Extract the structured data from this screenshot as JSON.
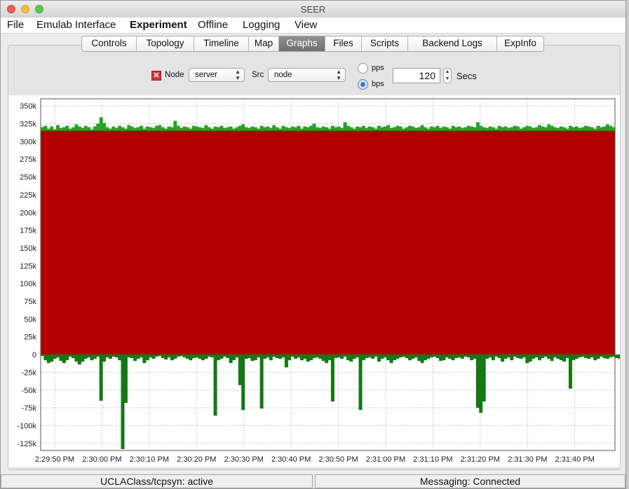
{
  "window": {
    "title": "SEER"
  },
  "menus": [
    {
      "label": "File",
      "bold": false
    },
    {
      "label": "Emulab Interface",
      "bold": false
    },
    {
      "label": "Experiment",
      "bold": true
    },
    {
      "label": "Offline",
      "bold": false
    },
    {
      "label": "Logging",
      "bold": false
    },
    {
      "label": "View",
      "bold": false
    }
  ],
  "tabs": [
    {
      "label": "Controls"
    },
    {
      "label": "Topology"
    },
    {
      "label": "Timeline"
    },
    {
      "label": "Map"
    },
    {
      "label": "Graphs",
      "active": true
    },
    {
      "label": "Files"
    },
    {
      "label": "Scripts"
    },
    {
      "label": "Backend Logs"
    },
    {
      "label": "ExpInfo"
    }
  ],
  "controls": {
    "node_label": "Node",
    "node_checked": true,
    "node_value": "server",
    "src_label": "Src",
    "src_value": "node",
    "pps_label": "pps",
    "bps_label": "bps",
    "unit_selected": "bps",
    "window_value": "120",
    "secs_label": "Secs"
  },
  "chart_data": {
    "type": "bar",
    "ylim": [
      -135000,
      360000
    ],
    "y_ticks": [
      {
        "label": "350k",
        "value": 350000
      },
      {
        "label": "325k",
        "value": 325000
      },
      {
        "label": "300k",
        "value": 300000
      },
      {
        "label": "275k",
        "value": 275000
      },
      {
        "label": "250k",
        "value": 250000
      },
      {
        "label": "225k",
        "value": 225000
      },
      {
        "label": "200k",
        "value": 200000
      },
      {
        "label": "175k",
        "value": 175000
      },
      {
        "label": "150k",
        "value": 150000
      },
      {
        "label": "125k",
        "value": 125000
      },
      {
        "label": "100k",
        "value": 100000
      },
      {
        "label": "75k",
        "value": 75000
      },
      {
        "label": "50k",
        "value": 50000
      },
      {
        "label": "25k",
        "value": 25000
      },
      {
        "label": "0",
        "value": 0
      },
      {
        "label": "-25k",
        "value": -25000
      },
      {
        "label": "-50k",
        "value": -50000
      },
      {
        "label": "-75k",
        "value": -75000
      },
      {
        "label": "-100k",
        "value": -100000
      },
      {
        "label": "-125k",
        "value": -125000
      }
    ],
    "x_ticks": [
      "2:29:50 PM",
      "2:30:00 PM",
      "2:30:10 PM",
      "2:30:20 PM",
      "2:30:30 PM",
      "2:30:40 PM",
      "2:30:50 PM",
      "2:31:00 PM",
      "2:31:10 PM",
      "2:31:20 PM",
      "2:31:30 PM",
      "2:31:40 PM"
    ],
    "grid": true,
    "series": [
      {
        "color": "#b00000",
        "fill": "area",
        "value_approx": 315000
      },
      {
        "color": "#1fa81f",
        "fill": "upper band",
        "values": [
          320000,
          322000,
          318000,
          321000,
          317000,
          323000,
          319000,
          320000,
          322000,
          318000,
          320000,
          324000,
          321000,
          319000,
          322000,
          320000,
          317000,
          321000,
          325000,
          334000,
          326000,
          320000,
          318000,
          321000,
          319000,
          322000,
          320000,
          318000,
          323000,
          321000,
          319000,
          320000,
          322000,
          318000,
          321000,
          320000,
          319000,
          322000,
          323000,
          320000,
          318000,
          321000,
          320000,
          329000,
          322000,
          319000,
          321000,
          320000,
          318000,
          322000,
          321000,
          320000,
          319000,
          323000,
          320000,
          318000,
          321000,
          320000,
          322000,
          319000,
          320000,
          321000,
          318000,
          320000,
          322000,
          324000,
          320000,
          319000,
          321000,
          320000,
          318000,
          322000,
          320000,
          321000,
          319000,
          323000,
          320000,
          318000,
          322000,
          320000,
          319000,
          321000,
          320000,
          322000,
          318000,
          321000,
          320000,
          322000,
          325000,
          320000,
          319000,
          321000,
          320000,
          318000,
          322000,
          320000,
          321000,
          319000,
          327000,
          322000,
          320000,
          318000,
          321000,
          320000,
          322000,
          319000,
          321000,
          320000,
          318000,
          322000,
          320000,
          321000,
          323000,
          319000,
          320000,
          322000,
          321000,
          318000,
          320000,
          322000,
          321000,
          319000,
          320000,
          323000,
          320000,
          318000,
          321000,
          320000,
          322000,
          319000,
          321000,
          320000,
          318000,
          322000,
          320000,
          321000,
          319000,
          320000,
          322000,
          321000,
          320000,
          327000,
          322000,
          320000,
          319000,
          321000,
          320000,
          318000,
          322000,
          320000,
          321000,
          319000,
          320000,
          322000,
          321000,
          318000,
          320000,
          322000,
          321000,
          319000,
          320000,
          323000,
          321000,
          320000,
          324000,
          322000,
          320000,
          319000,
          321000,
          320000,
          318000,
          322000,
          320000,
          321000,
          319000,
          320000,
          322000,
          321000,
          320000,
          318000,
          322000,
          320000,
          321000,
          324000,
          322000,
          320000
        ]
      },
      {
        "color": "#147814",
        "fill": "negative bars",
        "values": [
          -2000,
          -8000,
          -12000,
          -10000,
          -6000,
          -4000,
          -9000,
          -12000,
          -8000,
          -3000,
          -5000,
          -10000,
          -14000,
          -10000,
          -6000,
          -4000,
          -8000,
          -6000,
          -3000,
          -65000,
          -10000,
          -4000,
          -6000,
          -3000,
          -4000,
          -8000,
          -133000,
          -68000,
          -4000,
          -5000,
          -9000,
          -6000,
          -4000,
          -12000,
          -8000,
          -4000,
          -6000,
          -3000,
          -2000,
          -5000,
          -7000,
          -4000,
          -8000,
          -6000,
          -3000,
          -2000,
          -4000,
          -6000,
          -8000,
          -5000,
          -4000,
          -6000,
          -8000,
          -6000,
          -3000,
          -4000,
          -86000,
          -8000,
          -6000,
          -3000,
          -5000,
          -12000,
          -8000,
          -4000,
          -43000,
          -78000,
          -6000,
          -5000,
          -9000,
          -8000,
          -4000,
          -76000,
          -6000,
          -4000,
          -8000,
          -3000,
          -5000,
          -6000,
          -4000,
          -18000,
          -8000,
          -3000,
          -6000,
          -4000,
          -8000,
          -6000,
          -10000,
          -8000,
          -5000,
          -4000,
          -6000,
          -9000,
          -12000,
          -8000,
          -66000,
          -5000,
          -4000,
          -6000,
          -3000,
          -8000,
          -10000,
          -6000,
          -4000,
          -78000,
          -8000,
          -5000,
          -4000,
          -6000,
          -3000,
          -10000,
          -6000,
          -4000,
          -8000,
          -12000,
          -8000,
          -6000,
          -4000,
          -3000,
          -5000,
          -8000,
          -6000,
          -4000,
          -9000,
          -12000,
          -8000,
          -6000,
          -4000,
          -3000,
          -5000,
          -9000,
          -8000,
          -4000,
          -6000,
          -8000,
          -5000,
          -4000,
          -6000,
          -3000,
          -4000,
          -8000,
          -6000,
          -75000,
          -82000,
          -66000,
          -6000,
          -4000,
          -8000,
          -3000,
          -5000,
          -10000,
          -6000,
          -4000,
          -8000,
          -3000,
          -5000,
          -6000,
          -4000,
          -12000,
          -10000,
          -6000,
          -4000,
          -8000,
          -5000,
          -3000,
          -6000,
          -9000,
          -4000,
          -6000,
          -8000,
          -10000,
          -5000,
          -48000,
          -8000,
          -6000,
          -4000,
          -3000,
          -5000,
          -6000,
          -4000,
          -8000,
          -6000,
          -3000,
          -5000,
          -6000,
          -4000,
          -3000,
          -5000,
          -6000,
          -2000
        ]
      }
    ]
  },
  "status": {
    "left": "UCLAClass/tcpsyn: active",
    "right": "Messaging: Connected"
  }
}
